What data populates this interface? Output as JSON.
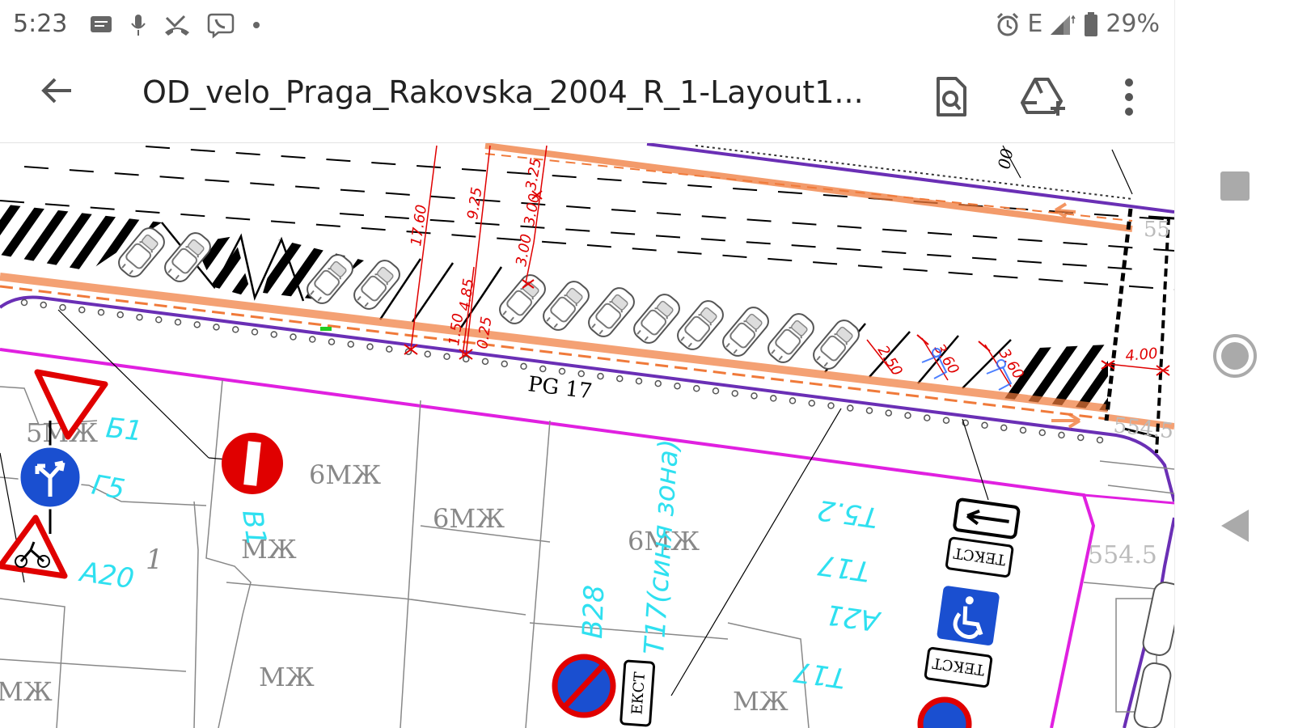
{
  "status_bar": {
    "time": "5:23",
    "network": "E",
    "battery": "29%",
    "left_icons": [
      "message-icon",
      "mic-icon",
      "missed-call-icon",
      "viber-icon",
      "dot-icon"
    ],
    "right_icons": [
      "alarm-icon",
      "signal-icon",
      "battery-icon"
    ]
  },
  "toolbar": {
    "title": "OD_velo_Praga_Rakovska_2004_R_1-Layout1...",
    "icons": [
      "back-arrow-icon",
      "find-in-page-icon",
      "add-to-drive-icon",
      "more-vert-icon"
    ]
  },
  "drawing": {
    "labels": {
      "pg17": "PG 17",
      "zone_5mzh": "5МЖ",
      "zone_6mzh_a": "6МЖ",
      "zone_6mzh_b": "6МЖ",
      "zone_6mzh_c": "6МЖ",
      "mzh_a": "МЖ",
      "mzh_b": "МЖ",
      "mzh_c": "МЖ",
      "mzh_d": "МЖ",
      "lot_1": "1",
      "sign_b1": "Б1",
      "sign_g5": "Г5",
      "sign_a20": "А20",
      "sign_v1": "В1",
      "sign_v28": "В28",
      "sign_t17_zone": "Т17(синя зона)",
      "sign_t52": "Т5.2",
      "sign_t17_a": "Т17",
      "sign_t17_b": "Т17",
      "sign_a21": "А21",
      "text_plate_a": "ТЕКСТ",
      "text_plate_b": "ТЕКСТ",
      "text_plate_c": "ЕКСТ",
      "elev_a": "554.5",
      "elev_b": "554.5",
      "elev_c": "55",
      "edge_num": "00"
    },
    "dimensions": [
      "17.60",
      "9.25",
      "3.25",
      "3.00",
      "3.00",
      "4.85",
      "1.50",
      "0.25",
      "2.50",
      "3.60",
      "3.60",
      "4.00"
    ]
  },
  "colors": {
    "curb_purple": "#6a2fb5",
    "lot_magenta": "#e020e0",
    "orange_lane": "#f07a3a",
    "dim_red": "#e00000",
    "cyan_text": "#2fe0f0",
    "sign_blue": "#1a4fd0"
  },
  "nav": {
    "icons": [
      "recents-square-icon",
      "home-circle-icon",
      "back-triangle-icon"
    ]
  }
}
